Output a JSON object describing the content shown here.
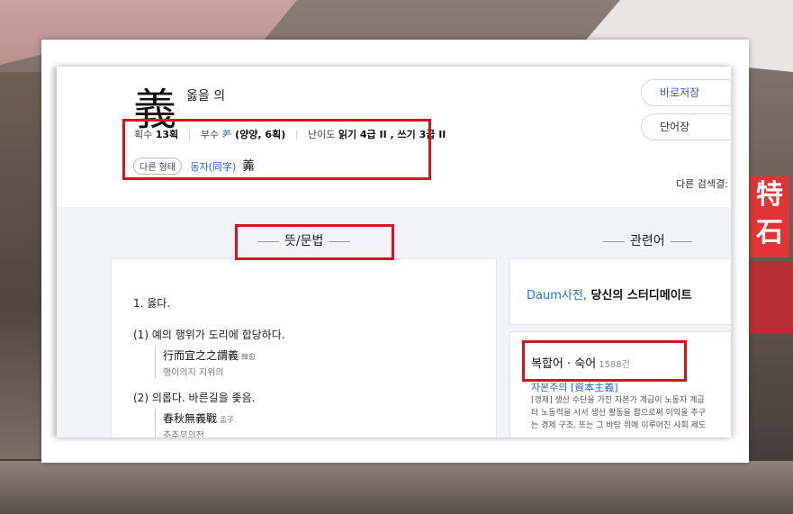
{
  "background": {
    "sign_chars": [
      "特",
      "石"
    ]
  },
  "entry": {
    "hanja": "義",
    "meaning": "옳을 의",
    "meta": {
      "strokes_label": "획수",
      "strokes_value": "13획",
      "radical_label": "부수",
      "radical_char": "⺶",
      "radical_detail": "(양양, 6획)",
      "difficulty_label": "난이도",
      "difficulty_value": "읽기 4급 II , 쓰기 3급 II"
    },
    "alt_forms": {
      "chip_label": "다른 형태",
      "link_label": "동자(同字)",
      "char": "羛"
    }
  },
  "buttons": {
    "save": "바로저장",
    "vocab": "단어장"
  },
  "other_search": "다른 검색결:",
  "sections": {
    "meaning_title": "뜻/문법",
    "related_title": "관련어"
  },
  "definitions": {
    "d1": "1.  옳다.",
    "d1_1": "(1)  예의 행위가 도리에 합당하다.",
    "ex1_han": "行而宜之之謂義",
    "ex1_src": "韓愈",
    "ex1_reading": "행이의지 지위의",
    "d1_2": "(2)  의롭다. 바른길을 좇음.",
    "ex2_han": "春秋無義戰",
    "ex2_src": "孟子",
    "ex2_reading": "춘추무의전"
  },
  "daum": {
    "brand": "Daum사전,",
    "text": " 당신의 스터디메이트"
  },
  "compound": {
    "title": "복합어 · 숙어",
    "count": "1588건",
    "entry_link": "자본주의 [資本主義]",
    "desc_lines": [
      "[경제] 생산 수단을 가진 자본가 계급이 노동자 계급",
      "터 노동력을 사서 생산 활동을 함으로써 이익을 추구",
      "는 경제 구조. 또는 그 바탕 위에 이루어진 사회 제도"
    ]
  },
  "colors": {
    "highlight": "#d9121f",
    "link": "#2468c8",
    "brand": "#1f6fd1"
  }
}
